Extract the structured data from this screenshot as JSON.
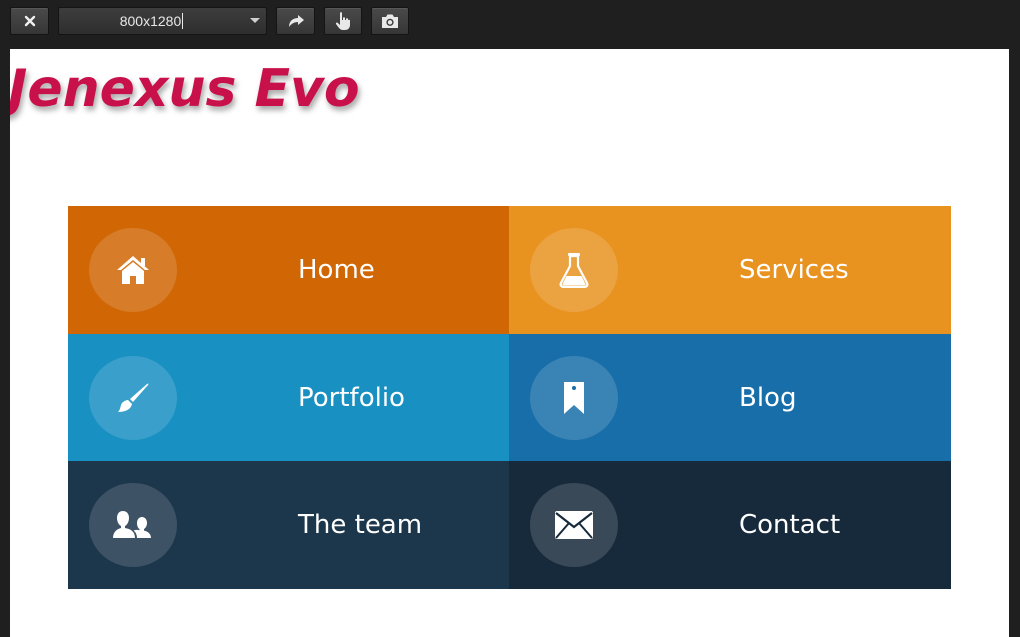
{
  "toolbar": {
    "close_icon": "close-icon",
    "resolution_value": "800x1280",
    "rotate_icon": "rotate-icon",
    "touch_icon": "touch-icon",
    "screenshot_icon": "camera-icon"
  },
  "page": {
    "brand": "Jenexus Evo",
    "brand_color": "#c8104a"
  },
  "menu": {
    "items": [
      {
        "label": "Home",
        "icon": "home-icon",
        "color": "#d06604"
      },
      {
        "label": "Services",
        "icon": "flask-icon",
        "color": "#e8921f"
      },
      {
        "label": "Portfolio",
        "icon": "brush-icon",
        "color": "#1890c2"
      },
      {
        "label": "Blog",
        "icon": "bookmark-icon",
        "color": "#186ea8"
      },
      {
        "label": "The team",
        "icon": "team-icon",
        "color": "#1c364b"
      },
      {
        "label": "Contact",
        "icon": "envelope-icon",
        "color": "#172a3b"
      }
    ]
  }
}
